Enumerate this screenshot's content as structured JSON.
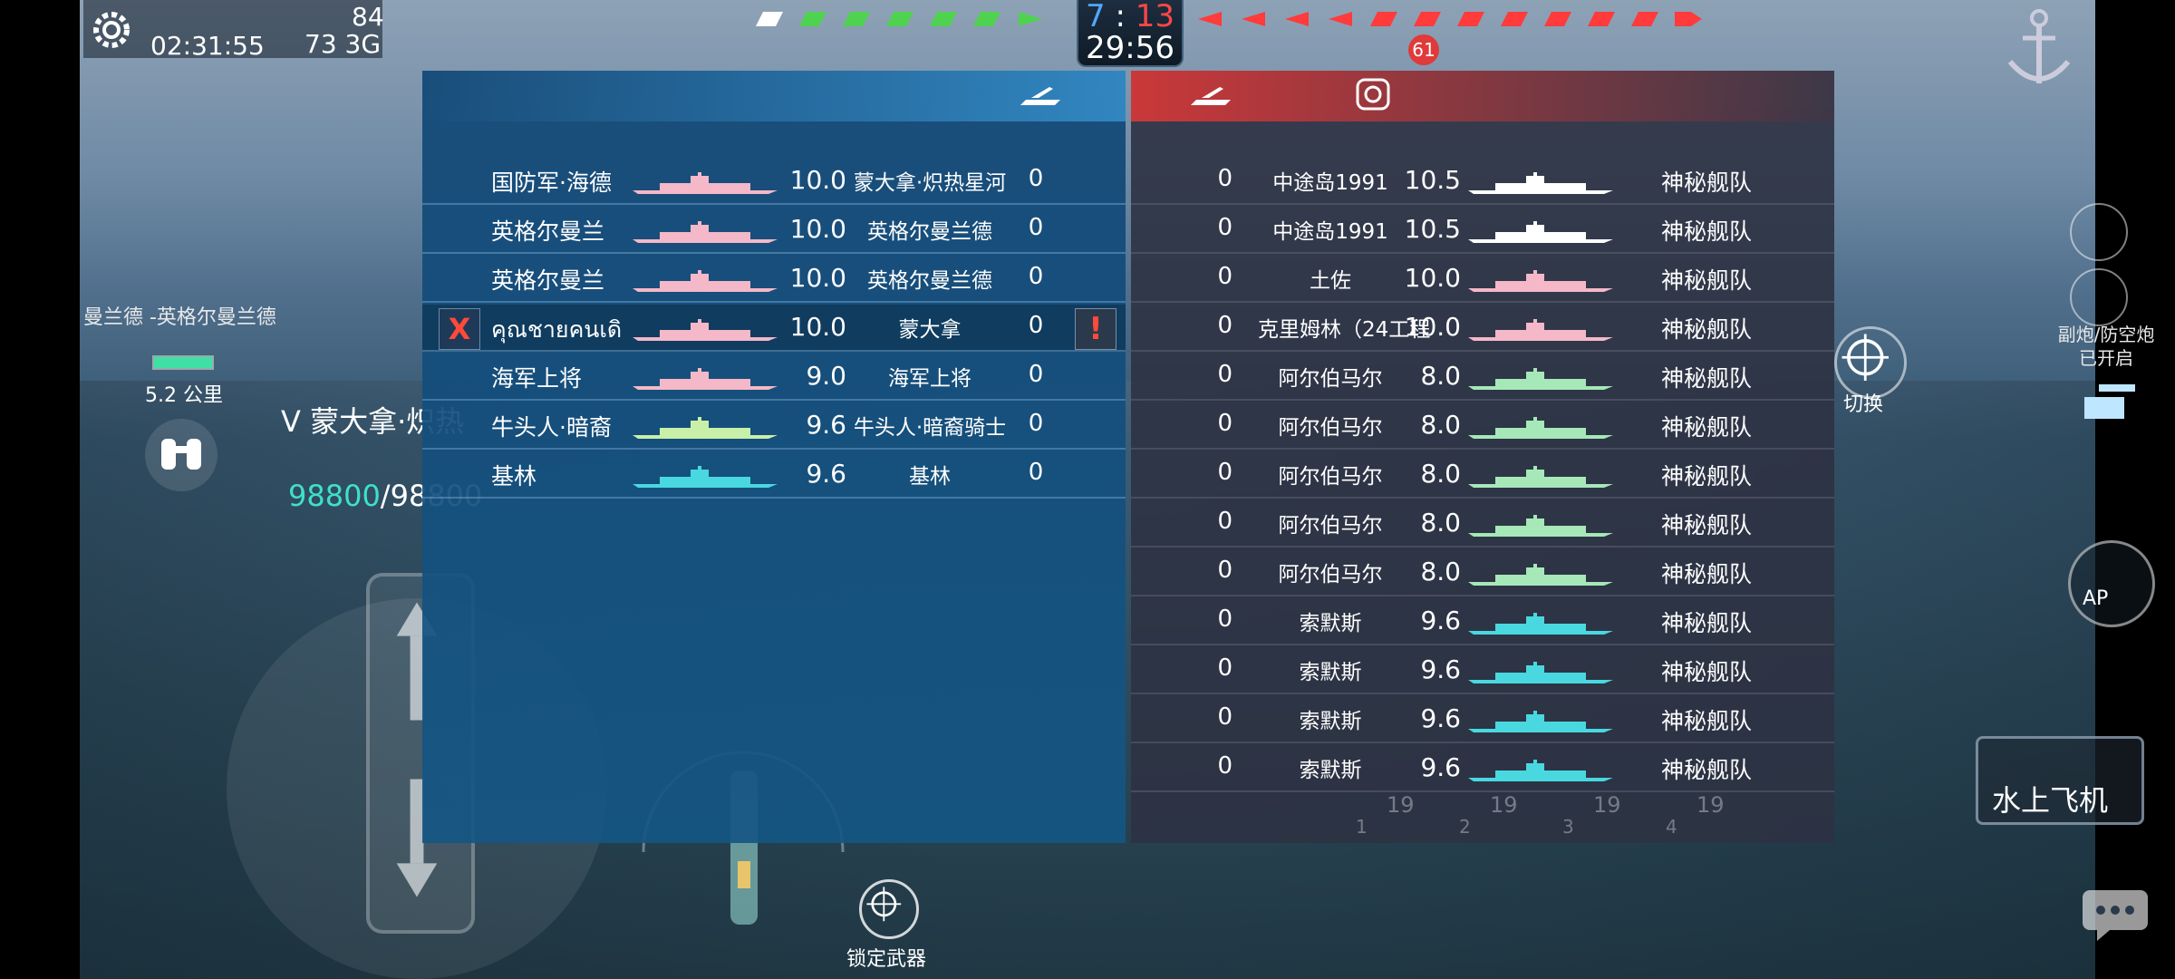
{
  "status": {
    "time": "02:31:55",
    "signal": "73 3G",
    "ping": "84"
  },
  "top": {
    "score_blue": "7",
    "score_sep": ":",
    "score_red": "13",
    "timer": "29:56",
    "notification_count": "61"
  },
  "left_team": {
    "rows": [
      {
        "name": "国防军·海德",
        "score": "10.0",
        "team": "蒙大拿·炽热星河",
        "kills": "0",
        "ship_color": "#f4b8c8"
      },
      {
        "name": "英格尔曼兰",
        "score": "10.0",
        "team": "英格尔曼兰德",
        "kills": "0",
        "ship_color": "#f4b8c8"
      },
      {
        "name": "英格尔曼兰",
        "score": "10.0",
        "team": "英格尔曼兰德",
        "kills": "0",
        "ship_color": "#f4b8c8"
      },
      {
        "name": "คุณชายคนเดิ",
        "score": "10.0",
        "team": "蒙大拿",
        "kills": "0",
        "ship_color": "#f4b8c8"
      },
      {
        "name": "海军上将",
        "score": "9.0",
        "team": "海军上将",
        "kills": "0",
        "ship_color": "#f4b8c8"
      },
      {
        "name": "牛头人·暗裔",
        "score": "9.6",
        "team": "牛头人·暗裔骑士",
        "kills": "0",
        "ship_color": "#c8f0a8"
      },
      {
        "name": "基林",
        "score": "9.6",
        "team": "基林",
        "kills": "0",
        "ship_color": "#49d8e0"
      }
    ],
    "kick_label": "X",
    "report_label": "!"
  },
  "right_team": {
    "rows": [
      {
        "kills": "0",
        "name": "中途岛1991",
        "score": "10.5",
        "team": "神秘舰队",
        "ship_color": "#ffffff"
      },
      {
        "kills": "0",
        "name": "中途岛1991",
        "score": "10.5",
        "team": "神秘舰队",
        "ship_color": "#ffffff"
      },
      {
        "kills": "0",
        "name": "土佐",
        "score": "10.0",
        "team": "神秘舰队",
        "ship_color": "#f4b8c8"
      },
      {
        "kills": "0",
        "name": "克里姆林（24工程",
        "score": "10.0",
        "team": "神秘舰队",
        "ship_color": "#f4b8c8"
      },
      {
        "kills": "0",
        "name": "阿尔伯马尔",
        "score": "8.0",
        "team": "神秘舰队",
        "ship_color": "#a6e8b8"
      },
      {
        "kills": "0",
        "name": "阿尔伯马尔",
        "score": "8.0",
        "team": "神秘舰队",
        "ship_color": "#a6e8b8"
      },
      {
        "kills": "0",
        "name": "阿尔伯马尔",
        "score": "8.0",
        "team": "神秘舰队",
        "ship_color": "#a6e8b8"
      },
      {
        "kills": "0",
        "name": "阿尔伯马尔",
        "score": "8.0",
        "team": "神秘舰队",
        "ship_color": "#a6e8b8"
      },
      {
        "kills": "0",
        "name": "阿尔伯马尔",
        "score": "8.0",
        "team": "神秘舰队",
        "ship_color": "#a6e8b8"
      },
      {
        "kills": "0",
        "name": "索默斯",
        "score": "9.6",
        "team": "神秘舰队",
        "ship_color": "#49d8e0"
      },
      {
        "kills": "0",
        "name": "索默斯",
        "score": "9.6",
        "team": "神秘舰队",
        "ship_color": "#49d8e0"
      },
      {
        "kills": "0",
        "name": "索默斯",
        "score": "9.6",
        "team": "神秘舰队",
        "ship_color": "#49d8e0"
      },
      {
        "kills": "0",
        "name": "索默斯",
        "score": "9.6",
        "team": "神秘舰队",
        "ship_color": "#49d8e0"
      }
    ]
  },
  "footer": {
    "labels": [
      "19",
      "19",
      "19",
      "19"
    ],
    "indices": [
      "1",
      "2",
      "3",
      "4"
    ]
  },
  "hud": {
    "enemy_label": "曼兰德 -英格尔曼兰德",
    "distance": "5.2 公里",
    "target_name": "V 蒙大拿·炽热",
    "hp_current": "98800",
    "hp_total": "/98800",
    "lock_label": "锁定武器",
    "switch_label": "切换",
    "aa_label_1": "副炮/防空炮",
    "aa_label_2": "已开启",
    "ap_label": "AP",
    "seaplane_label": "水上飞机"
  },
  "colors": {
    "blue_team": "#4fa8ff",
    "red_team": "#ff4747",
    "hp": "#3fe0c8"
  }
}
